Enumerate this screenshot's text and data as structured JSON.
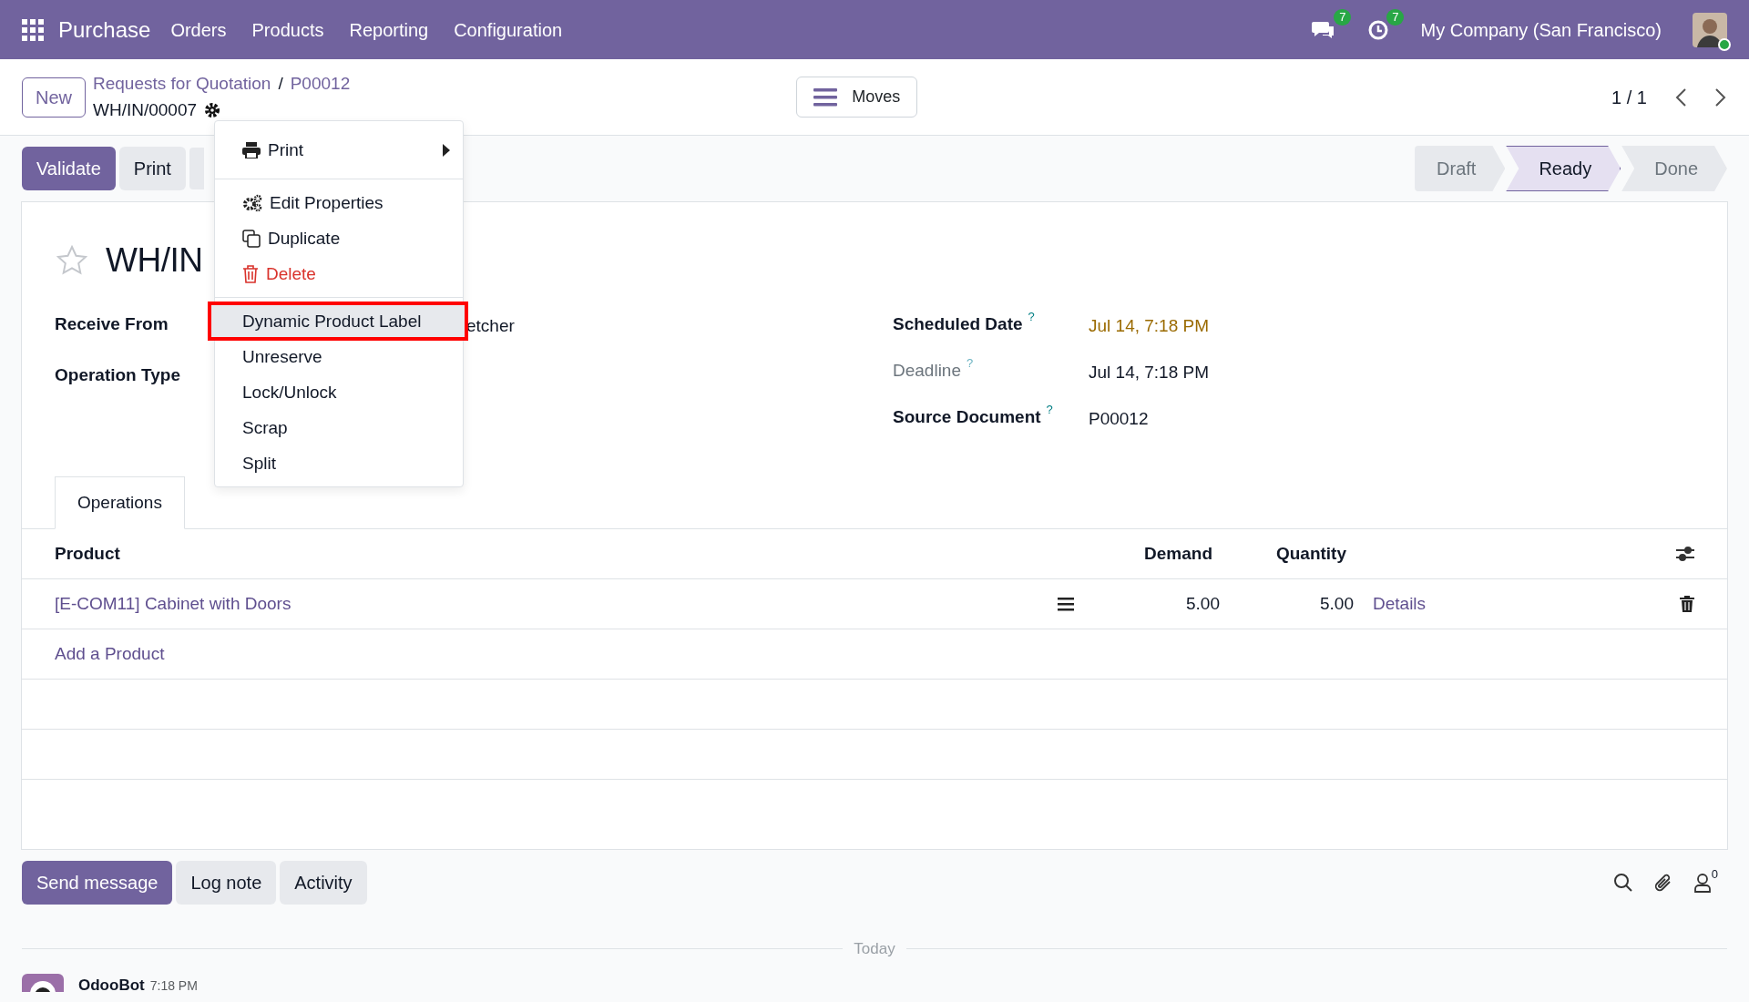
{
  "navbar": {
    "app_name": "Purchase",
    "menu": [
      "Orders",
      "Products",
      "Reporting",
      "Configuration"
    ],
    "messages_count": "7",
    "activities_count": "7",
    "company": "My Company (San Francisco)",
    "online": true
  },
  "control_panel": {
    "new_button": "New",
    "breadcrumbs": [
      "Requests for Quotation",
      "P00012"
    ],
    "breadcrumb_separator": "/",
    "record_name": "WH/IN/00007",
    "moves_button": "Moves",
    "pager": "1 / 1"
  },
  "actions": [
    {
      "label": "Validate",
      "kind": "primary"
    },
    {
      "label": "Print",
      "kind": "secondary"
    }
  ],
  "status": [
    {
      "label": "Draft",
      "selected": false
    },
    {
      "label": "Ready",
      "selected": true
    },
    {
      "label": "Done",
      "selected": false
    }
  ],
  "form": {
    "title": "WH/IN",
    "starred": false,
    "left_fields": [
      {
        "label": "Receive From",
        "value": "etcher"
      },
      {
        "label": "Operation Type"
      }
    ],
    "right_fields": [
      {
        "label": "Scheduled Date",
        "help": "?",
        "value": "Jul 14, 7:18 PM",
        "muted": false,
        "warning": true
      },
      {
        "label": "Deadline",
        "help": "?",
        "value": "Jul 14, 7:18 PM",
        "muted": true,
        "warning": false
      },
      {
        "label": "Source Document",
        "help": "?",
        "value": "P00012",
        "muted": false,
        "warning": false
      }
    ],
    "tabs": [
      {
        "label": "Operations",
        "selected": true
      }
    ],
    "table": {
      "columns": [
        "Product",
        "Demand",
        "Quantity"
      ],
      "rows": [
        {
          "product": "[E-COM11] Cabinet with Doors",
          "demand": "5.00",
          "quantity": "5.00",
          "details": "Details"
        }
      ],
      "add_link": "Add a Product"
    }
  },
  "menu": {
    "items": [
      {
        "kind": "print",
        "label": "Print",
        "selected": false
      },
      {
        "kind": "divider"
      },
      {
        "kind": "properties",
        "label": "Edit Properties",
        "selected": false
      },
      {
        "kind": "duplicate",
        "label": "Duplicate",
        "selected": false
      },
      {
        "kind": "delete",
        "label": "Delete",
        "selected": false
      },
      {
        "kind": "divider"
      },
      {
        "kind": "action",
        "label": "Dynamic Product Label",
        "selected": true
      },
      {
        "kind": "action",
        "label": "Unreserve",
        "selected": false
      },
      {
        "kind": "action",
        "label": "Lock/Unlock",
        "selected": false
      },
      {
        "kind": "action",
        "label": "Scrap",
        "selected": false
      },
      {
        "kind": "action",
        "label": "Split",
        "selected": false
      }
    ]
  },
  "chatter": {
    "buttons": [
      {
        "label": "Send message",
        "kind": "primary"
      },
      {
        "label": "Log note",
        "kind": "secondary"
      },
      {
        "label": "Activity",
        "kind": "secondary"
      }
    ],
    "followers_count": "0",
    "date_separator": "Today",
    "messages": [
      {
        "author": "OdooBot",
        "time": "7:18 PM"
      }
    ]
  }
}
